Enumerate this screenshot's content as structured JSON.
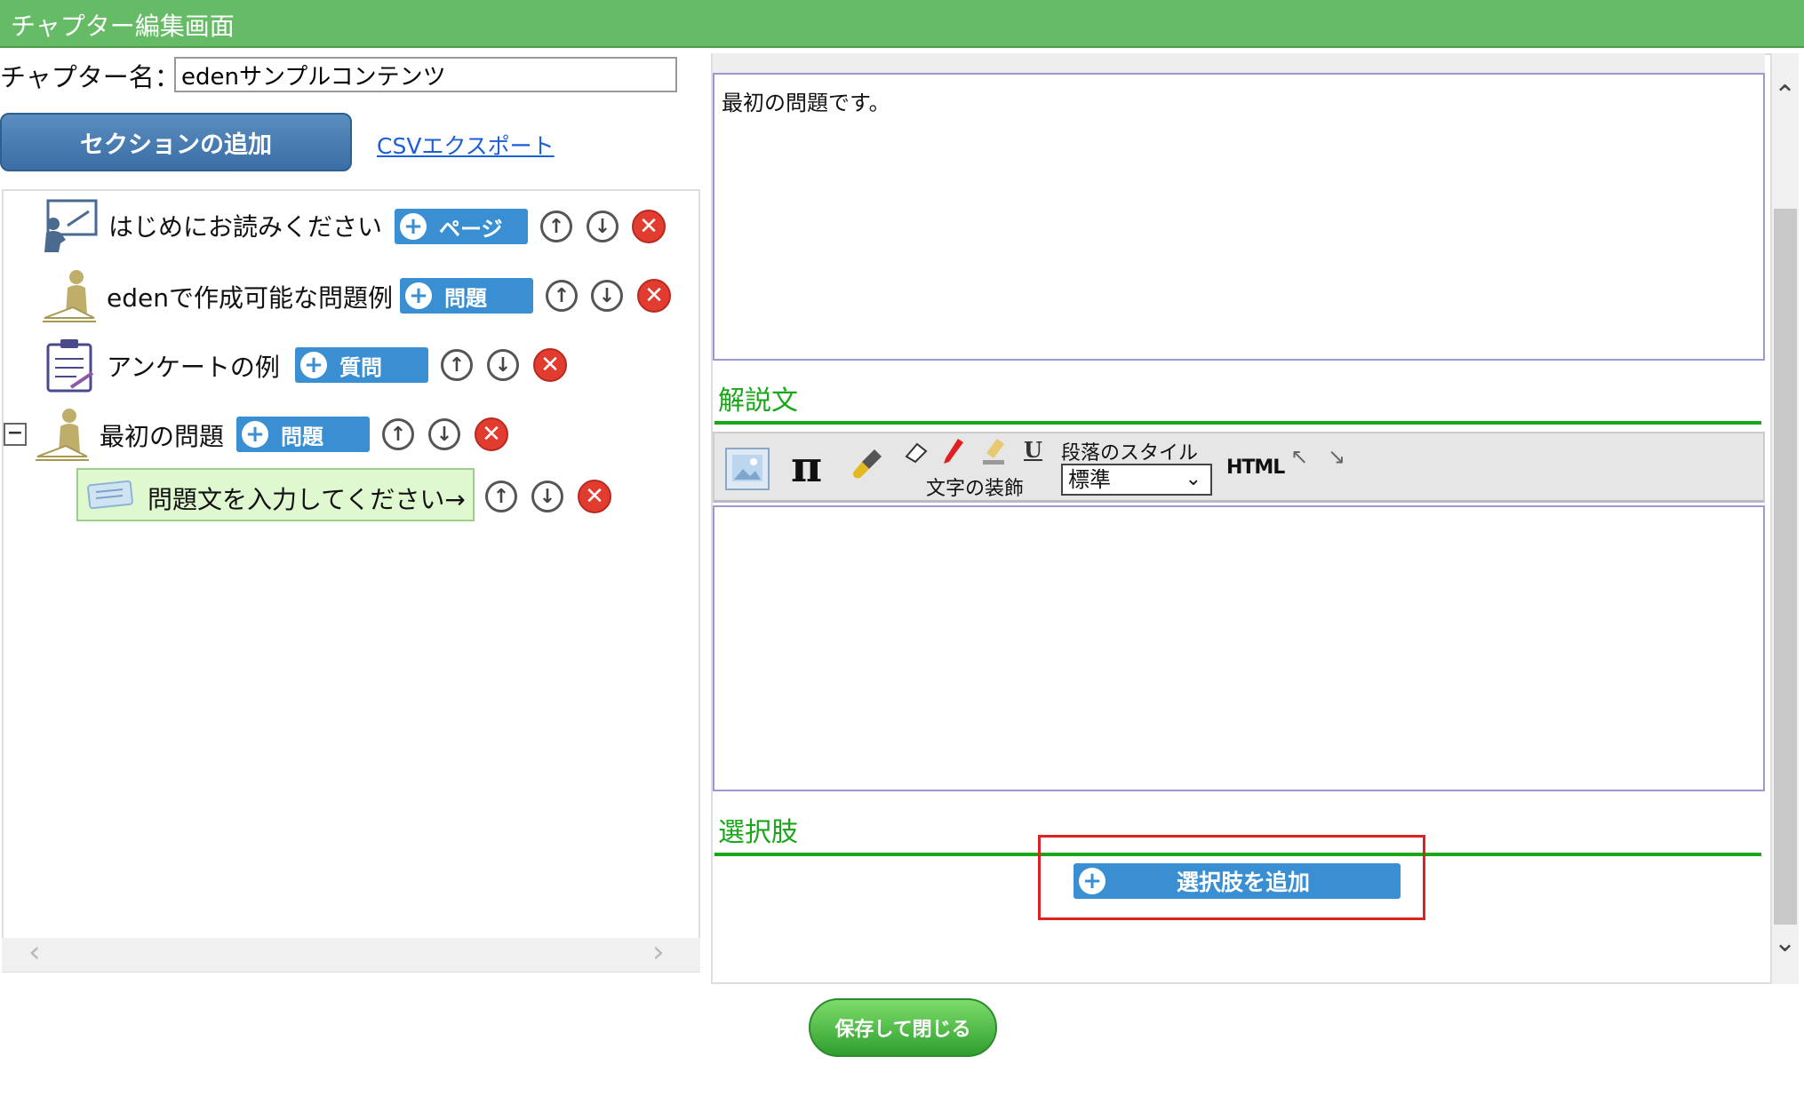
{
  "window": {
    "title": "チャプター編集画面"
  },
  "chapter": {
    "label": "チャプター名：",
    "name_value": "edenサンプルコンテンツ"
  },
  "actions": {
    "add_section": "セクションの追加",
    "csv_export": "CSVエクスポート",
    "save_close": "保存して閉じる"
  },
  "tree": {
    "items": [
      {
        "label": "はじめにお読みください",
        "add_label": "ページ",
        "icon": "presentation-icon"
      },
      {
        "label": "edenで作成可能な問題例",
        "add_label": "問題",
        "icon": "person-writing-icon"
      },
      {
        "label": "アンケートの例",
        "add_label": "質問",
        "icon": "clipboard-icon"
      },
      {
        "label": "最初の問題",
        "add_label": "問題",
        "icon": "person-writing-icon"
      }
    ],
    "child": {
      "label": "問題文を入力してください→",
      "icon": "card-icon"
    },
    "collapse_symbol": "−"
  },
  "editor": {
    "question_text": "最初の問題です。",
    "explanation_title": "解説文",
    "choices_title": "選択肢",
    "add_choice": "選択肢を追加",
    "toolbar": {
      "decoration_label": "文字の装飾",
      "paragraph_style_label": "段落のスタイル",
      "paragraph_style_value": "標準",
      "html_label": "HTML",
      "pi_symbol": "π",
      "underline_symbol": "U"
    }
  },
  "colors": {
    "title_bar": "#66bb66",
    "accent_green": "#19a619",
    "button_blue": "#3a8fd2",
    "delete_red": "#e23b2f",
    "highlight": "#dd2222"
  }
}
